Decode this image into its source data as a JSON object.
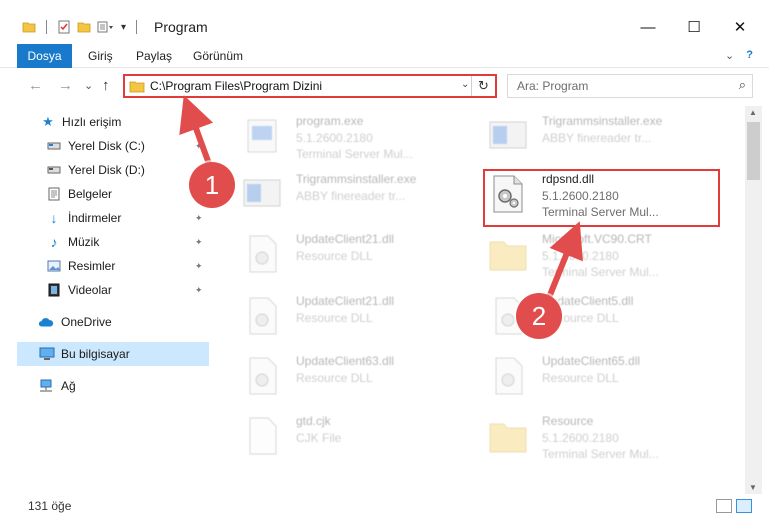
{
  "window": {
    "title": "Program",
    "minimize_glyph": "—",
    "maximize_glyph": "☐",
    "close_glyph": "✕"
  },
  "ribbon": {
    "tabs": [
      "Dosya",
      "Giriş",
      "Paylaş",
      "Görünüm"
    ],
    "expand_glyph": "⌄",
    "help_glyph": "?"
  },
  "nav": {
    "back_glyph": "←",
    "forward_glyph": "→",
    "recent_glyph": "⌄",
    "up_glyph": "↑"
  },
  "address": {
    "path": "C:\\Program Files\\Program Dizini",
    "dropdown_glyph": "⌄",
    "refresh_glyph": "↻"
  },
  "search": {
    "placeholder": "Ara: Program",
    "icon_glyph": "⌕"
  },
  "sidebar": {
    "items": [
      {
        "label": "Hızlı erişim",
        "icon": "star-icon"
      },
      {
        "label": "Yerel Disk (C:)",
        "icon": "drive-icon"
      },
      {
        "label": "Yerel Disk (D:)",
        "icon": "drive-icon"
      },
      {
        "label": "Belgeler",
        "icon": "documents-icon"
      },
      {
        "label": "İndirmeler",
        "icon": "download-icon"
      },
      {
        "label": "Müzik",
        "icon": "music-icon"
      },
      {
        "label": "Resimler",
        "icon": "pictures-icon"
      },
      {
        "label": "Videolar",
        "icon": "videos-icon"
      },
      {
        "label": "OneDrive",
        "icon": "cloud-icon"
      },
      {
        "label": "Bu bilgisayar",
        "icon": "computer-icon"
      },
      {
        "label": "Ağ",
        "icon": "network-icon"
      }
    ]
  },
  "files": [
    {
      "name": "program.exe",
      "version": "5.1.2600.2180",
      "desc": "Terminal Server Mul..."
    },
    {
      "name": "Trigrammsinstaller.exe",
      "version": "ABBY finereader tr...",
      "desc": ""
    },
    {
      "name": "Trigrammsinstaller.exe",
      "version": "ABBY finereader tr...",
      "desc": ""
    },
    {
      "name": "rdpsnd.dll",
      "version": "5.1.2600.2180",
      "desc": "Terminal Server Mul..."
    },
    {
      "name": "UpdateClient21.dll",
      "version": "Resource DLL",
      "desc": ""
    },
    {
      "name": "Microsoft.VC90.CRT",
      "version": "5.1.2600.2180",
      "desc": "Terminal Server Mul..."
    },
    {
      "name": "UpdateClient21.dll",
      "version": "Resource DLL",
      "desc": ""
    },
    {
      "name": "UpdateClient5.dll",
      "version": "Resource DLL",
      "desc": ""
    },
    {
      "name": "UpdateClient63.dll",
      "version": "Resource DLL",
      "desc": ""
    },
    {
      "name": "UpdateClient65.dll",
      "version": "Resource DLL",
      "desc": ""
    },
    {
      "name": "gtd.cjk",
      "version": "CJK File",
      "desc": ""
    },
    {
      "name": "Resource",
      "version": "5.1.2600.2180",
      "desc": "Terminal Server Mul..."
    }
  ],
  "status": {
    "count": "131 öğe"
  },
  "annotations": {
    "step1": "1",
    "step2": "2"
  },
  "colors": {
    "accent": "#1979ca",
    "highlight": "#e23b3b",
    "selection": "#cce8ff"
  }
}
